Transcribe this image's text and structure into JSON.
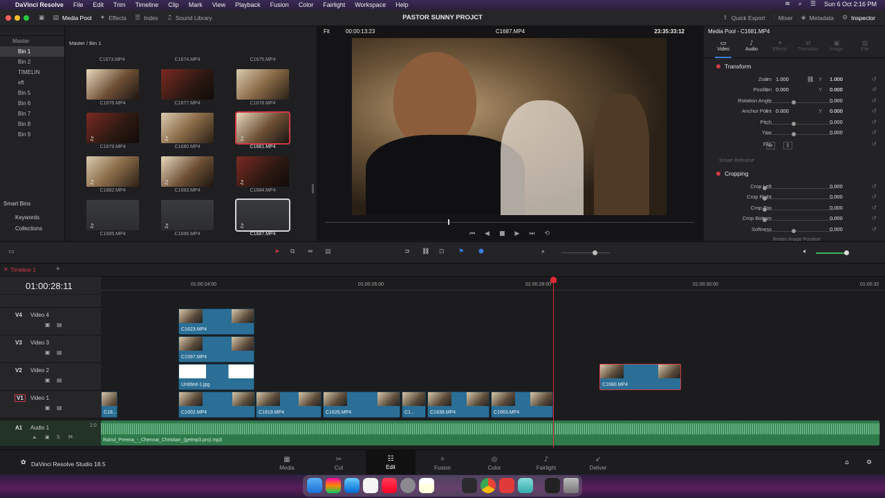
{
  "menubar": {
    "app": "DaVinci Resolve",
    "items": [
      "File",
      "Edit",
      "Trim",
      "Timeline",
      "Clip",
      "Mark",
      "View",
      "Playback",
      "Fusion",
      "Color",
      "Fairlight",
      "Workspace",
      "Help"
    ],
    "datetime": "Sun 6 Oct  2:16 PM"
  },
  "toolbar": {
    "media_pool": "Media Pool",
    "effects": "Effects",
    "index": "Index",
    "sound_library": "Sound Library",
    "project_title": "PASTOR SUNNY PROJCT",
    "quick_export": "Quick Export",
    "mixer": "Mixer",
    "metadata": "Metadata",
    "inspector": "Inspector"
  },
  "bins": {
    "master": "Master",
    "items": [
      "Bin 1",
      "Bin 2",
      "TIMELIN",
      "eft",
      "Bin 5",
      "Bin 6",
      "Bin 7",
      "Bin 8",
      "Bin 9"
    ],
    "smart_bins": "Smart Bins",
    "keywords": "Keywords",
    "collections": "Collections"
  },
  "media": {
    "path": "Master / Bin 1",
    "top_row": [
      "C1673.MP4",
      "C1674.MP4",
      "C1675.MP4"
    ],
    "clips": [
      "C1676.MP4",
      "C1677.MP4",
      "C1678.MP4",
      "C1679.MP4",
      "C1680.MP4",
      "C1681.MP4",
      "C1682.MP4",
      "C1683.MP4",
      "C1684.MP4",
      "C1685.MP4",
      "C1686.MP4",
      "C1687.MP4"
    ]
  },
  "viewer": {
    "fit": "Fit",
    "timecode_left": "00:00:13:23",
    "clip_name": "C1687.MP4",
    "timecode_right": "23:35:33:12"
  },
  "inspector": {
    "title": "Media Pool - C1681.MP4",
    "tabs": [
      "Video",
      "Audio",
      "Effects",
      "Transition",
      "Image",
      "File"
    ],
    "transform": "Transform",
    "zoom_label": "Zoom",
    "zoom_x": "1.000",
    "zoom_y": "1.000",
    "position_label": "Position",
    "pos_x": "0.000",
    "pos_y": "0.000",
    "rotation_label": "Rotation Angle",
    "rotation": "0.000",
    "anchor_label": "Anchor Point",
    "anchor_x": "0.000",
    "anchor_y": "0.000",
    "pitch_label": "Pitch",
    "pitch": "0.000",
    "yaw_label": "Yaw",
    "yaw": "0.000",
    "flip_label": "Flip",
    "smart_reframe": "Smart Reframe",
    "cropping": "Cropping",
    "crop_left_label": "Crop Left",
    "crop_left": "0.000",
    "crop_right_label": "Crop Right",
    "crop_right": "0.000",
    "crop_top_label": "Crop Top",
    "crop_top": "0.000",
    "crop_bottom_label": "Crop Bottom",
    "crop_bottom": "0.000",
    "softness_label": "Softness",
    "softness": "0.000",
    "retain_label": "Retain Image Position",
    "x": "X",
    "y": "Y"
  },
  "timeline": {
    "tab": "Timeline 1",
    "timecode": "01:00:28:11",
    "ruler": [
      "01:00:24:00",
      "01:00:26:00",
      "01:00:28:00",
      "01:00:30:00",
      "01:00:32"
    ],
    "tracks": [
      {
        "id": "V4",
        "name": "Video 4"
      },
      {
        "id": "V3",
        "name": "Video 3"
      },
      {
        "id": "V2",
        "name": "Video 2"
      },
      {
        "id": "V1",
        "name": "Video 1"
      },
      {
        "id": "A1",
        "name": "Audio 1"
      }
    ],
    "audio_level": "2.0",
    "clips_v4": [
      "C1623.MP4"
    ],
    "clips_v3": [
      "C1597.MP4"
    ],
    "clips_v2": [
      "Untitled-1.jpg",
      "C1680.MP4"
    ],
    "clips_v1": [
      "C18...",
      "C1602.MP4",
      "C1819.MP4",
      "C1626.MP4",
      "C1...",
      "C1838.MP4",
      "C1663.MP4"
    ],
    "audio_clip": "Rahul_Preena_-_Chennai_Christian_(getmp3.pro).mp3"
  },
  "pages": {
    "brand": "DaVinci Resolve Studio 18.5",
    "items": [
      "Media",
      "Cut",
      "Edit",
      "Fusion",
      "Color",
      "Fairlight",
      "Deliver"
    ],
    "active": "Edit"
  },
  "colors": {
    "accent_red": "#d23a47",
    "clip_blue": "#2b6f96",
    "audio_green": "#2f7a4b"
  }
}
